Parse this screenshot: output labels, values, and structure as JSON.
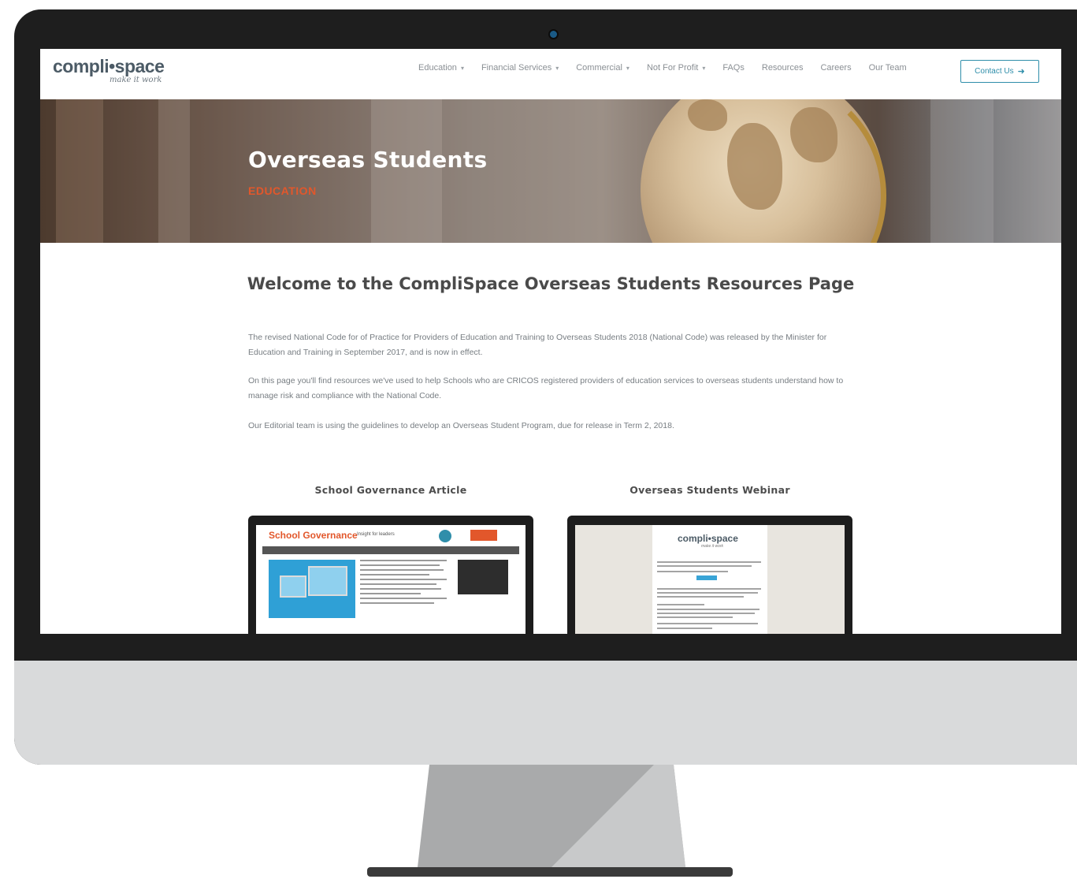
{
  "site": {
    "logo_word": "compli•space",
    "logo_tagline": "make it work"
  },
  "nav": {
    "items": [
      {
        "label": "Education",
        "has_caret": true
      },
      {
        "label": "Financial Services",
        "has_caret": true
      },
      {
        "label": "Commercial",
        "has_caret": true
      },
      {
        "label": "Not For Profit",
        "has_caret": true
      },
      {
        "label": "FAQs",
        "has_caret": false
      },
      {
        "label": "Resources",
        "has_caret": false
      },
      {
        "label": "Careers",
        "has_caret": false
      },
      {
        "label": "Our Team",
        "has_caret": false
      }
    ],
    "contact_label": "Contact Us",
    "contact_icon": "arrow-circle-icon"
  },
  "hero": {
    "title": "Overseas Students",
    "subtitle": "EDUCATION"
  },
  "content": {
    "heading": "Welcome to the CompliSpace Overseas Students Resources Page",
    "paragraphs": [
      "The revised National Code for of Practice for Providers of Education and Training to Overseas Students 2018 (National Code) was released by the Minister for Education and Training in September 2017, and is now in effect.",
      "On this page you'll find resources we've used to help Schools who are CRICOS registered providers of education services to overseas students understand how to manage risk and compliance with the National Code.",
      "Our Editorial team is using the guidelines to develop an Overseas Student Program, due for release in Term 2, 2018."
    ]
  },
  "resources": [
    {
      "title": "School Governance Article"
    },
    {
      "title": "Overseas Students Webinar"
    }
  ],
  "thumbnails": {
    "school_governance": {
      "title": "School Governance",
      "tagline": "Insight for leaders"
    },
    "webinar": {
      "logo_word": "compli•space",
      "logo_tagline": "make it work"
    }
  },
  "colors": {
    "accent_orange": "#e2572b",
    "accent_blue": "#2f8eaa",
    "frame": "#1e1e1e",
    "chin": "#d9dadb"
  }
}
